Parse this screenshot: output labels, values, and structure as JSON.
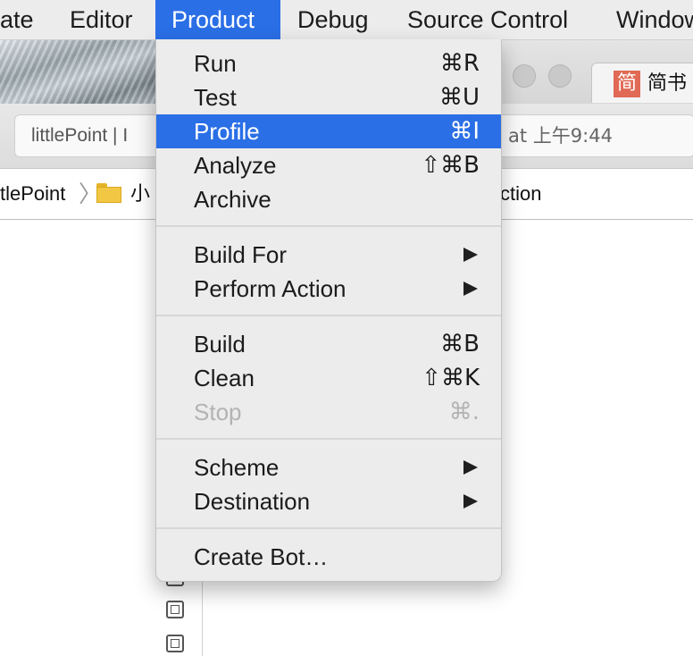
{
  "menubar": {
    "items": [
      "ate",
      "Editor",
      "Product",
      "Debug",
      "Source Control",
      "Window"
    ]
  },
  "background_window": {
    "browser_tab": {
      "logo": "简",
      "title": "简书"
    },
    "status": {
      "left": "littlePoint  |  I",
      "right": "at 上午9:44"
    },
    "breadcrumb": {
      "project": "tlePoint",
      "folder": "小",
      "trailing": "ction"
    }
  },
  "product_menu": {
    "groups": [
      [
        {
          "label": "Run",
          "shortcut": "⌘R"
        },
        {
          "label": "Test",
          "shortcut": "⌘U"
        },
        {
          "label": "Profile",
          "shortcut": "⌘I"
        },
        {
          "label": "Analyze",
          "shortcut": "⇧⌘B"
        },
        {
          "label": "Archive",
          "shortcut": ""
        }
      ],
      [
        {
          "label": "Build For",
          "shortcut": ""
        },
        {
          "label": "Perform Action",
          "shortcut": ""
        }
      ],
      [
        {
          "label": "Build",
          "shortcut": "⌘B"
        },
        {
          "label": "Clean",
          "shortcut": "⇧⌘K"
        },
        {
          "label": "Stop",
          "shortcut": "⌘."
        }
      ],
      [
        {
          "label": "Scheme",
          "shortcut": ""
        },
        {
          "label": "Destination",
          "shortcut": ""
        }
      ],
      [
        {
          "label": "Create Bot…",
          "shortcut": ""
        }
      ]
    ]
  },
  "colors": {
    "highlight": "#2a6fe6",
    "disabled_text": "#b3b3b3"
  }
}
